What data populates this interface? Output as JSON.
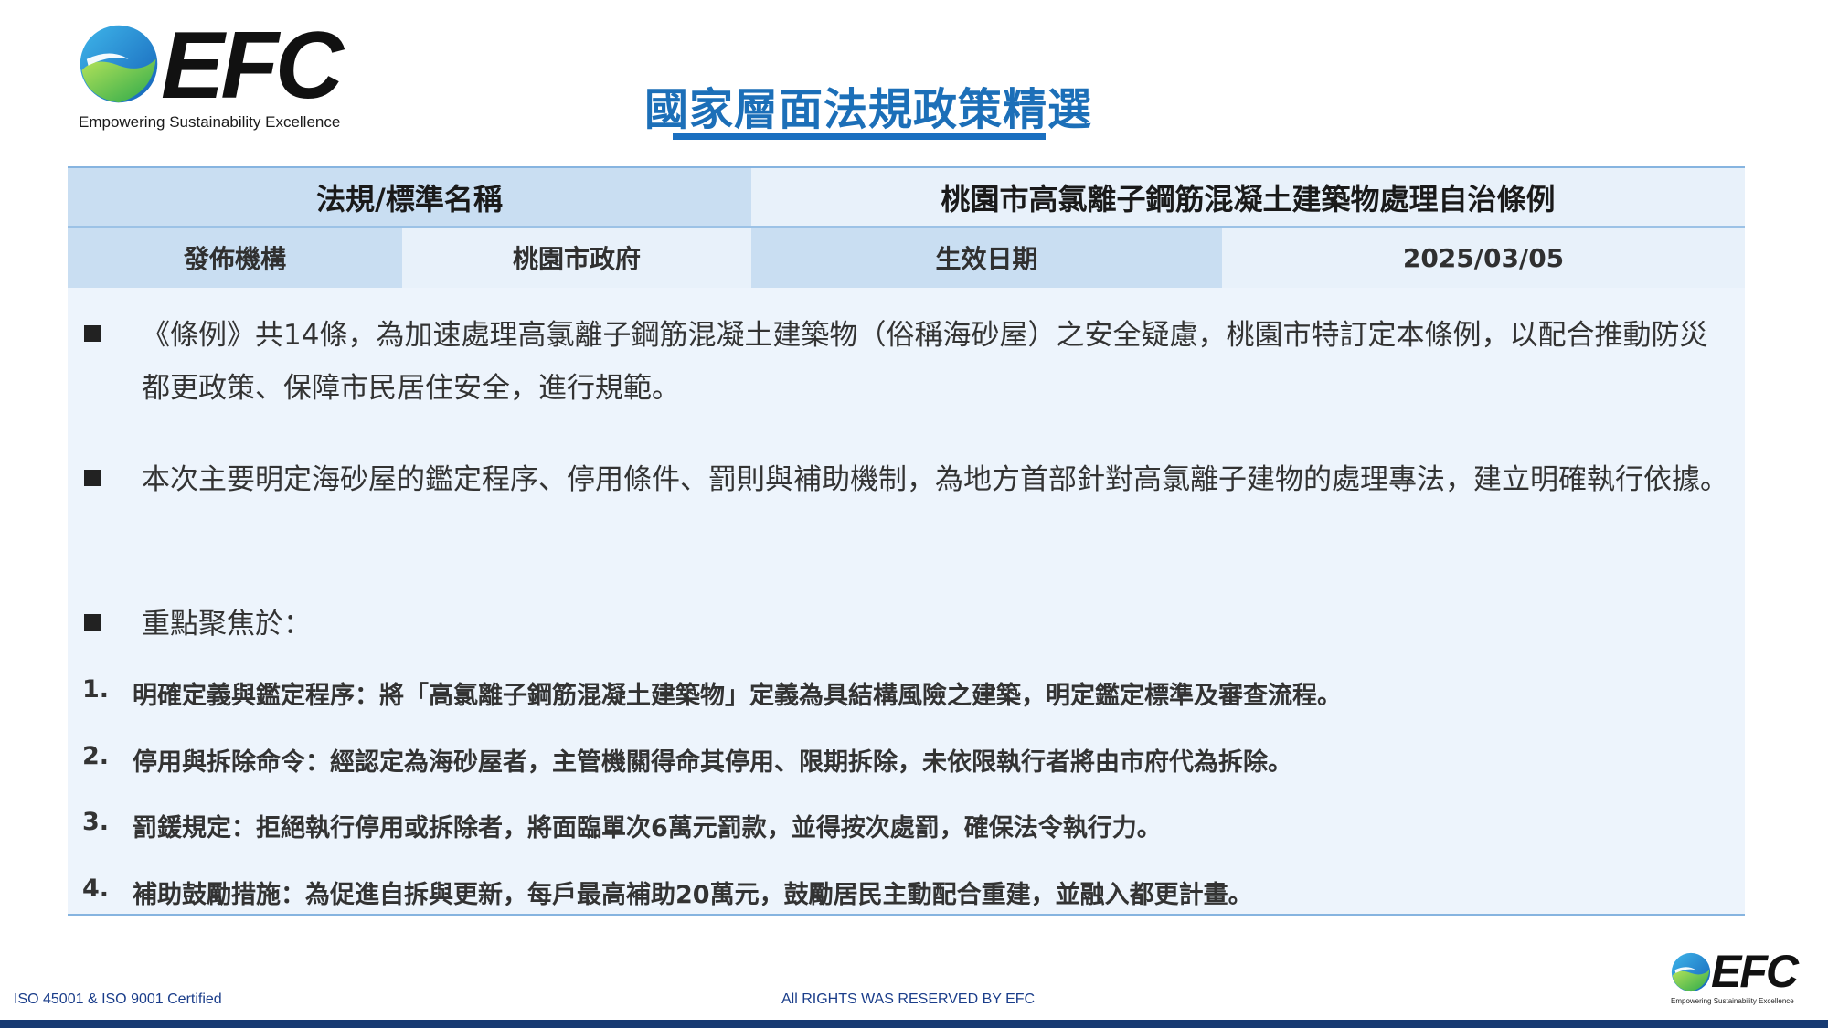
{
  "brand": {
    "name": "EFC",
    "tagline": "Empowering Sustainability Excellence"
  },
  "title": "國家層面法規政策精選",
  "table": {
    "name_label": "法規/標準名稱",
    "name_value": "桃園市高氯離子鋼筋混凝土建築物處理自治條例",
    "issuer_label": "發佈機構",
    "issuer_value": "桃園市政府",
    "date_label": "生效日期",
    "date_value": "2025/03/05"
  },
  "bullets": [
    "《條例》共14條，為加速處理高氯離子鋼筋混凝土建築物（俗稱海砂屋）之安全疑慮，桃園市特訂定本條例，以配合推動防災都更政策、保障市民居住安全，進行規範。",
    "本次主要明定海砂屋的鑑定程序、停用條件、罰則與補助機制，為地方首部針對高氯離子建物的處理專法，建立明確執行依據。",
    "重點聚焦於："
  ],
  "points": [
    {
      "num": "1.",
      "text": "明確定義與鑑定程序：將「高氯離子鋼筋混凝土建築物」定義為具結構風險之建築，明定鑑定標準及審查流程。"
    },
    {
      "num": "2.",
      "text": "停用與拆除命令：經認定為海砂屋者，主管機關得命其停用、限期拆除，未依限執行者將由市府代為拆除。"
    },
    {
      "num": "3.",
      "text": "罰鍰規定：拒絕執行停用或拆除者，將面臨單次6萬元罰款，並得按次處罰，確保法令執行力。"
    },
    {
      "num": "4.",
      "text": "補助鼓勵措施：為促進自拆與更新，每戶最高補助20萬元，鼓勵居民主動配合重建，並融入都更計畫。"
    }
  ],
  "footer": {
    "left": "ISO 45001 & ISO 9001 Certified",
    "center": "All RIGHTS WAS RESERVED BY EFC"
  },
  "colors": {
    "title": "#1c6fb8",
    "header_cell": "#c9def2",
    "value_cell": "#e8f1fa",
    "body_bg": "#edf4fc",
    "bottom_bar": "#173a72"
  }
}
